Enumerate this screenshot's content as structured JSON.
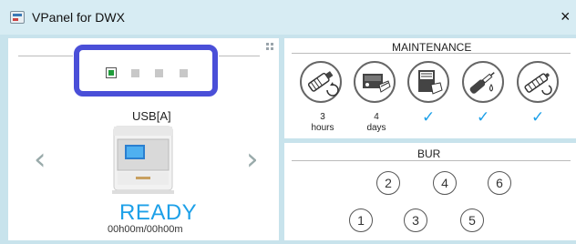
{
  "window": {
    "title": "VPanel for DWX",
    "close_label": "×"
  },
  "left_panel": {
    "device_port": "USB[A]",
    "status": "READY",
    "timer": "00h00m/00h00m",
    "prev_label": "‹",
    "next_label": "›",
    "device_slots": [
      {
        "state": "active"
      },
      {
        "state": "empty"
      },
      {
        "state": "empty"
      },
      {
        "state": "empty"
      }
    ]
  },
  "maintenance": {
    "title": "MAINTENANCE",
    "items": [
      {
        "icon": "spindle-rotation-icon",
        "value": "3",
        "unit": "hours",
        "check": ""
      },
      {
        "icon": "machine-cleaning-icon",
        "value": "4",
        "unit": "days",
        "check": ""
      },
      {
        "icon": "dust-collector-icon",
        "value": "",
        "unit": "",
        "check": "✓"
      },
      {
        "icon": "milling-bur-icon",
        "value": "",
        "unit": "",
        "check": "✓"
      },
      {
        "icon": "air-hose-icon",
        "value": "",
        "unit": "",
        "check": "✓"
      }
    ],
    "accent_color": "#1da0e8"
  },
  "bur": {
    "title": "BUR",
    "positions": [
      "2",
      "4",
      "6",
      "1",
      "3",
      "5"
    ]
  },
  "colors": {
    "background": "#c8e3ec",
    "selection_outline": "#4a4fd8",
    "ready_text": "#1da0e8",
    "active_slot": "#1e9c3a"
  }
}
